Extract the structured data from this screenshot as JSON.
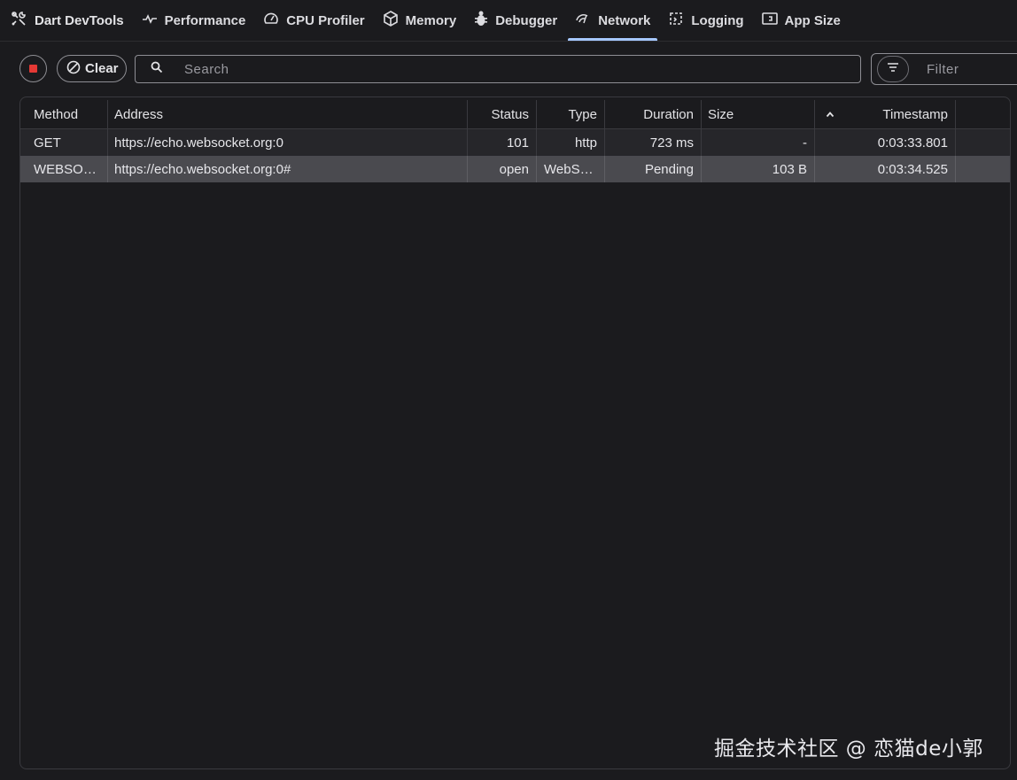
{
  "app": {
    "title": "Dart DevTools"
  },
  "tabs": [
    {
      "label": "Performance",
      "icon": "performance-icon"
    },
    {
      "label": "CPU Profiler",
      "icon": "speedometer-icon"
    },
    {
      "label": "Memory",
      "icon": "cube-icon"
    },
    {
      "label": "Debugger",
      "icon": "bug-icon"
    },
    {
      "label": "Network",
      "icon": "network-icon",
      "active": true
    },
    {
      "label": "Logging",
      "icon": "logging-icon"
    },
    {
      "label": "App Size",
      "icon": "app-size-icon"
    }
  ],
  "toolbar": {
    "clear_label": "Clear",
    "search_placeholder": "Search",
    "filter_placeholder": "Filter",
    "recording_indicator_color": "#e53935"
  },
  "table": {
    "columns": {
      "method": "Method",
      "address": "Address",
      "status": "Status",
      "type": "Type",
      "duration": "Duration",
      "size": "Size",
      "timestamp": "Timestamp"
    },
    "sort_direction": "ascending",
    "rows": [
      {
        "method": "GET",
        "address": "https://echo.websocket.org:0",
        "status": "101",
        "type": "http",
        "duration": "723 ms",
        "size": "-",
        "timestamp": "0:03:33.801",
        "selected": false
      },
      {
        "method": "WEBSOC…",
        "address": "https://echo.websocket.org:0#",
        "status": "open",
        "type": "WebSo…",
        "duration": "Pending",
        "size": "103 B",
        "timestamp": "0:03:34.525",
        "selected": true
      }
    ]
  },
  "watermark": "掘金技术社区 @ 恋猫de小郭",
  "colors": {
    "background": "#1b1b1e",
    "active_tab_indicator": "#a6c8ff",
    "selected_row": "#4a4a4f"
  }
}
